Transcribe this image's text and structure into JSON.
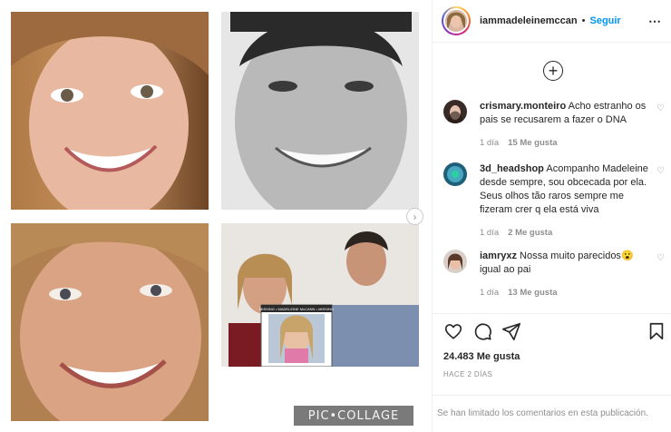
{
  "post": {
    "username": "iammadeleinemccan",
    "separator": "•",
    "follow_label": "Seguir",
    "more_icon": "more-horizontal-icon"
  },
  "media": {
    "watermark": "PIC•COLLAGE",
    "next_icon": "chevron-right-icon",
    "poster_text": "MISSING • MADELEINE McCANN • MISSING"
  },
  "comments": {
    "add_icon": "plus-circle-icon",
    "items": [
      {
        "user": "crismary.monteiro",
        "text": "Acho estranho os pais se recusarem a fazer o DNA",
        "time": "1 día",
        "likes": "15 Me gusta",
        "emoji": ""
      },
      {
        "user": "3d_headshop",
        "text": "Acompanho Madeleine desde sempre, sou obcecada por ela. Seus olhos tão raros sempre me fizeram crer q ela está viva",
        "time": "1 día",
        "likes": "2 Me gusta",
        "emoji": ""
      },
      {
        "user": "iamryxz",
        "text": "Nossa muito parecidos",
        "time": "1 día",
        "likes": "13 Me gusta",
        "emoji": "😮",
        "text_after": " igual ao pai"
      }
    ]
  },
  "actions": {
    "like_icon": "heart-icon",
    "comment_icon": "comment-icon",
    "share_icon": "share-icon",
    "save_icon": "bookmark-icon",
    "likes_count": "24.483 Me gusta",
    "ago": "HACE 2 DÍAS"
  },
  "footer": {
    "limited_text": "Se han limitado los comentarios en esta publicación."
  },
  "colors": {
    "accent": "#0095f6",
    "text": "#262626",
    "muted": "#8e8e8e",
    "border": "#efefef"
  }
}
